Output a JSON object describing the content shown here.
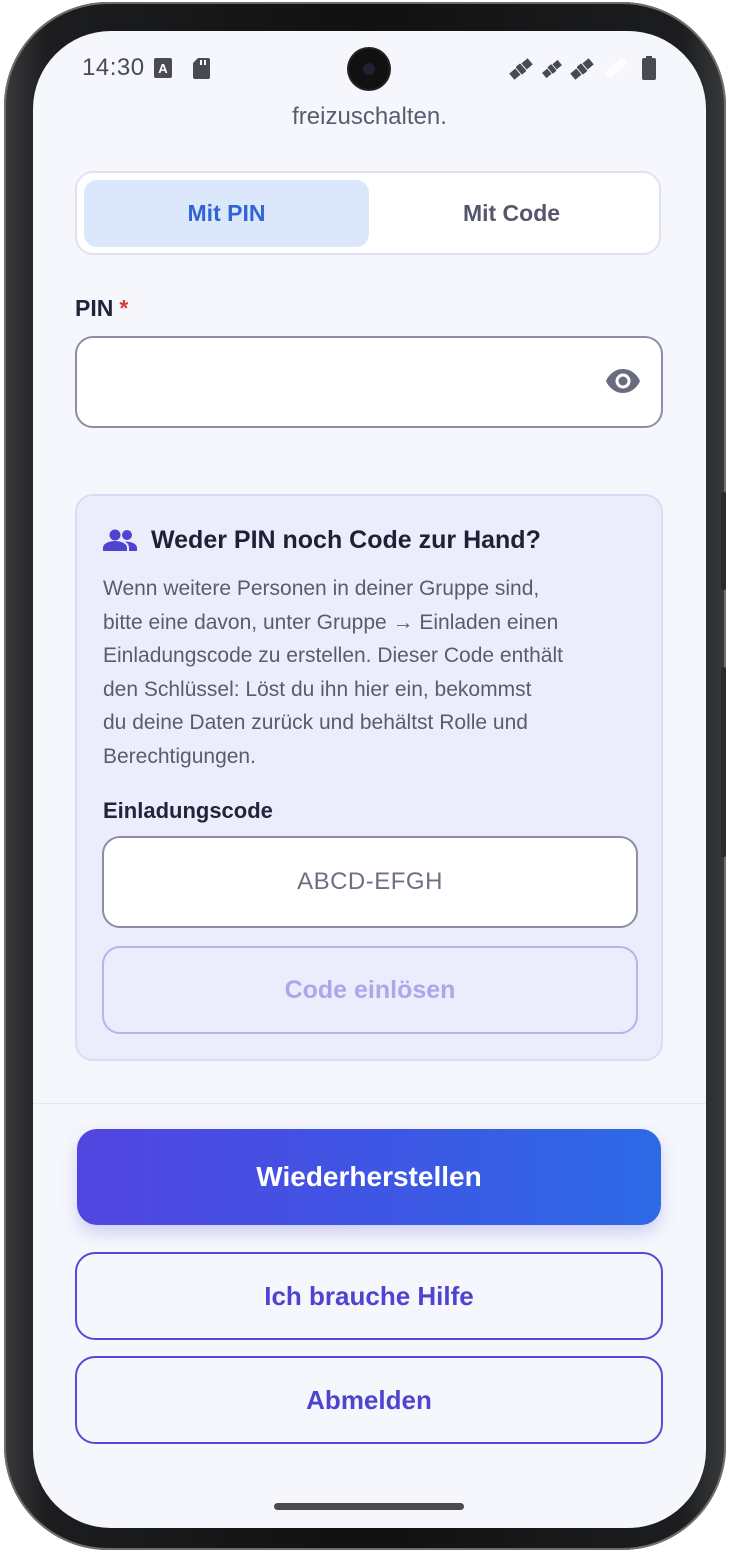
{
  "status_bar": {
    "time": "14:30"
  },
  "header": {
    "subtitle": "freizuschalten."
  },
  "tabs": [
    {
      "label": "Mit PIN",
      "active": true
    },
    {
      "label": "Mit Code",
      "active": false
    }
  ],
  "pin": {
    "label": "PIN",
    "required_mark": "*",
    "value": "",
    "visibility_icon": "eye-icon"
  },
  "help_card": {
    "icon": "group-icon",
    "title": "Weder PIN noch Code zur Hand?",
    "body_lines": [
      "Wenn weitere Personen in deiner Gruppe sind,",
      "bitte eine davon, unter Gruppe → Einladen einen",
      "Einladungscode zu erstellen. Dieser Code enthält",
      "den Schlüssel: Löst du ihn hier ein, bekommst",
      "du deine Daten zurück und behältst Rolle und",
      "Berechtigungen."
    ],
    "code_label": "Einladungscode",
    "code_placeholder": "ABCD-EFGH",
    "redeem_label": "Code einlösen"
  },
  "actions": {
    "restore_label": "Wiederherstellen",
    "help_label": "Ich brauche Hilfe",
    "logout_label": "Abmelden"
  },
  "colors": {
    "accent": "#3165d4",
    "primary_gradient_start": "#5145e0",
    "primary_gradient_end": "#2c6ae6",
    "outline": "#5a49d8",
    "required": "#d43b3b"
  }
}
